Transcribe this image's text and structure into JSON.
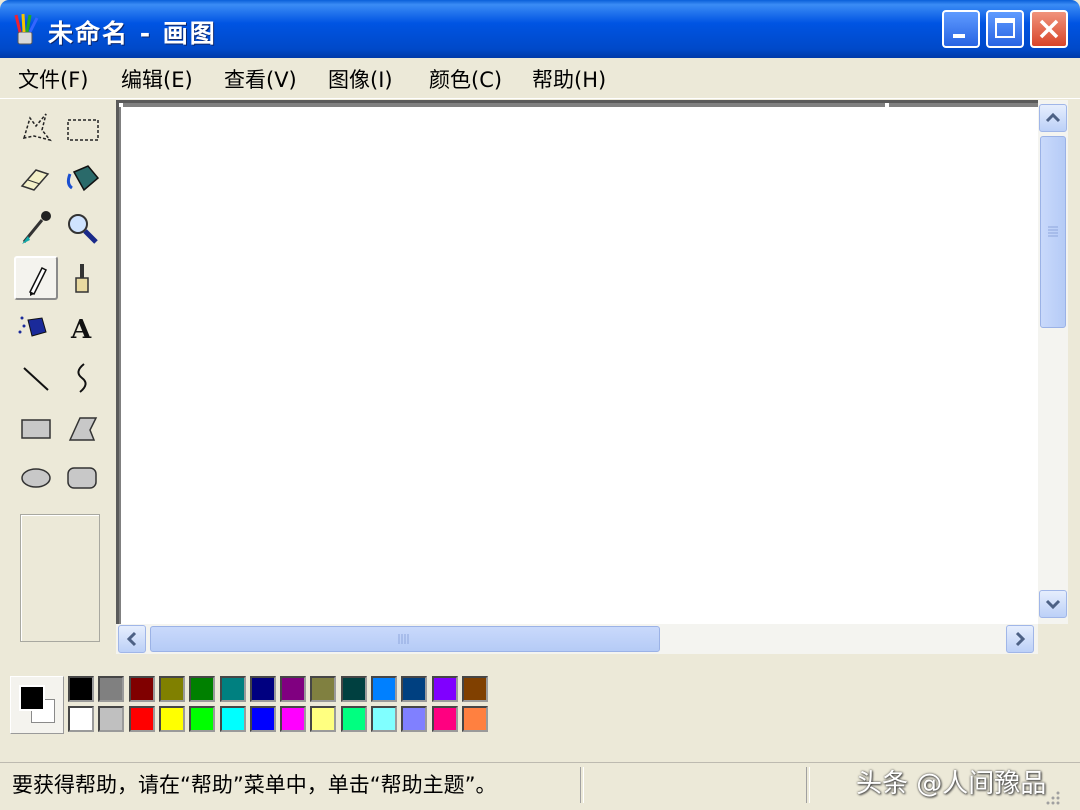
{
  "window": {
    "title": "未命名 - 画图",
    "controls": [
      "minimize",
      "maximize",
      "close"
    ]
  },
  "menu": [
    {
      "label": "文件(F)"
    },
    {
      "label": "编辑(E)"
    },
    {
      "label": "查看(V)"
    },
    {
      "label": "图像(I)"
    },
    {
      "label": "颜色(C)"
    },
    {
      "label": "帮助(H)"
    }
  ],
  "tools": [
    {
      "name": "free-form-select-icon"
    },
    {
      "name": "rect-select-icon"
    },
    {
      "name": "eraser-icon"
    },
    {
      "name": "fill-bucket-icon"
    },
    {
      "name": "color-picker-icon"
    },
    {
      "name": "magnifier-icon"
    },
    {
      "name": "pencil-icon",
      "active": true
    },
    {
      "name": "brush-icon"
    },
    {
      "name": "airbrush-icon"
    },
    {
      "name": "text-icon"
    },
    {
      "name": "line-icon"
    },
    {
      "name": "curve-icon"
    },
    {
      "name": "rectangle-icon"
    },
    {
      "name": "polygon-icon"
    },
    {
      "name": "ellipse-icon"
    },
    {
      "name": "rounded-rectangle-icon"
    }
  ],
  "palette": {
    "foreground": "#000000",
    "background": "#ffffff",
    "row1": [
      "#000000",
      "#808080",
      "#800000",
      "#808000",
      "#008000",
      "#008080",
      "#000080",
      "#800080",
      "#808040",
      "#004040",
      "#0080ff",
      "#004080",
      "#8000ff",
      "#804000"
    ],
    "row2": [
      "#ffffff",
      "#c0c0c0",
      "#ff0000",
      "#ffff00",
      "#00ff00",
      "#00ffff",
      "#0000ff",
      "#ff00ff",
      "#ffff80",
      "#00ff80",
      "#80ffff",
      "#8080ff",
      "#ff0080",
      "#ff8040"
    ]
  },
  "status": {
    "text": "要获得帮助，请在“帮助”菜单中，单击“帮助主题”。"
  },
  "watermark": "头条 @人间豫品",
  "colors": {
    "titlebar": "#0054e3",
    "chrome": "#ece9d8",
    "workspace": "#808080"
  }
}
